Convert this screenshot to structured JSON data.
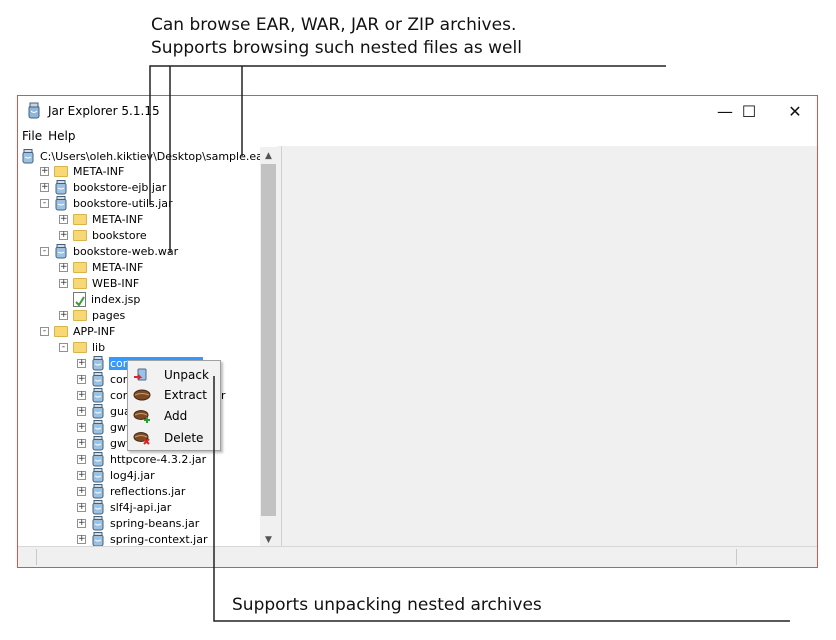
{
  "callouts": {
    "top_line1": "Can browse EAR, WAR, JAR or ZIP archives.",
    "top_line2": "Supports browsing such nested files as well",
    "bottom": "Supports unpacking nested archives"
  },
  "window": {
    "title": "Jar Explorer 5.1.15",
    "minimize_glyph": "—",
    "maximize_glyph": "☐",
    "close_glyph": "✕"
  },
  "menu": {
    "file": "File",
    "help": "Help"
  },
  "tree": {
    "root": "C:\\Users\\oleh.kiktiev\\Desktop\\sample.ear",
    "items": [
      {
        "label": "META-INF",
        "icon": "folder-icon"
      },
      {
        "label": "bookstore-ejb.jar",
        "icon": "jar-icon"
      },
      {
        "label": "bookstore-utils.jar",
        "icon": "jar-icon"
      },
      {
        "label": "META-INF",
        "icon": "folder-icon"
      },
      {
        "label": "bookstore",
        "icon": "folder-icon"
      },
      {
        "label": "bookstore-web.war",
        "icon": "jar-icon"
      },
      {
        "label": "META-INF",
        "icon": "folder-icon"
      },
      {
        "label": "WEB-INF",
        "icon": "folder-icon"
      },
      {
        "label": "index.jsp",
        "icon": "jsp-file-icon"
      },
      {
        "label": "pages",
        "icon": "folder-icon"
      },
      {
        "label": "APP-INF",
        "icon": "folder-icon"
      },
      {
        "label": "lib",
        "icon": "folder-icon"
      },
      {
        "label": "commo",
        "icon": "jar-icon"
      },
      {
        "label": "commo",
        "icon": "jar-icon"
      },
      {
        "label": "commo",
        "icon": "jar-icon"
      },
      {
        "label": "guava.",
        "icon": "jar-icon"
      },
      {
        "label": "gwt-aj",
        "icon": "jar-icon"
      },
      {
        "label": "gwt-ma",
        "icon": "jar-icon"
      },
      {
        "label": "httpcore-4.3.2.jar",
        "icon": "jar-icon"
      },
      {
        "label": "log4j.jar",
        "icon": "jar-icon"
      },
      {
        "label": "reflections.jar",
        "icon": "jar-icon"
      },
      {
        "label": "slf4j-api.jar",
        "icon": "jar-icon"
      },
      {
        "label": "spring-beans.jar",
        "icon": "jar-icon"
      },
      {
        "label": "spring-context.jar",
        "icon": "jar-icon"
      }
    ],
    "partial_suffix_row15": "r"
  },
  "context_menu": {
    "items": [
      {
        "label": "Unpack",
        "icon": "unpack-arrow-icon"
      },
      {
        "label": "Extract",
        "icon": "coffee-bean-icon"
      },
      {
        "label": "Add",
        "icon": "coffee-bean-add-icon"
      },
      {
        "label": "Delete",
        "icon": "coffee-bean-delete-icon"
      }
    ]
  },
  "colors": {
    "selection": "#3399ff",
    "window_border": "#d9534f",
    "folder": "#f8d775"
  }
}
